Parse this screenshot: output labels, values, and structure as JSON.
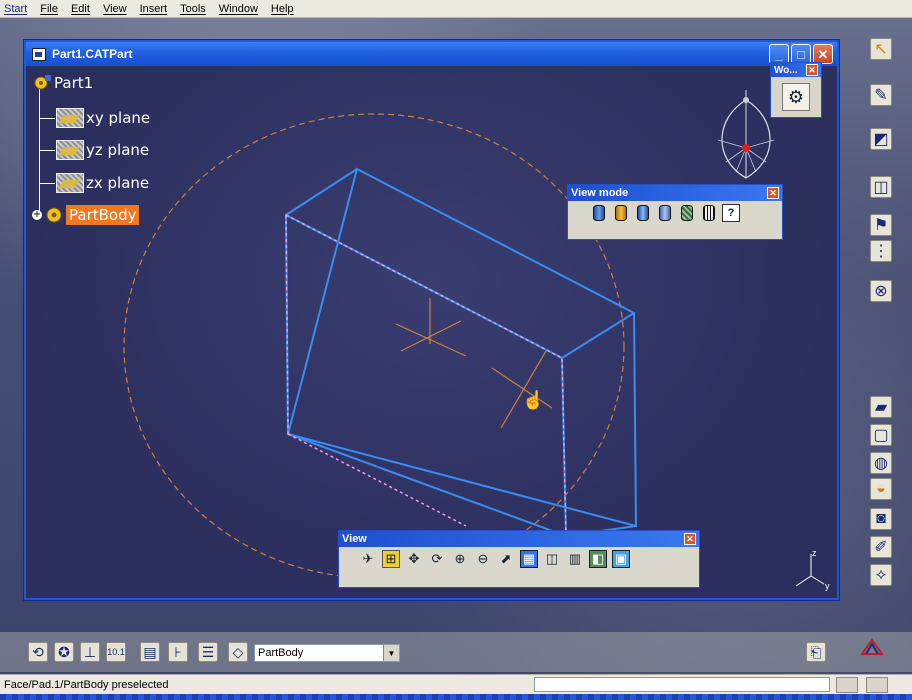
{
  "menu": {
    "items": [
      "Start",
      "File",
      "Edit",
      "View",
      "Insert",
      "Tools",
      "Window",
      "Help"
    ]
  },
  "document": {
    "title": "Part1.CATPart"
  },
  "tree": {
    "root": "Part1",
    "planes": [
      "xy plane",
      "yz plane",
      "zx plane"
    ],
    "body": "PartBody"
  },
  "workbench_box": {
    "title": "Wo..."
  },
  "view_mode_toolbar": {
    "title": "View mode",
    "icons": [
      "shading-icon",
      "shading-edges-icon",
      "shading-edges-no-smooth-icon",
      "shading-edges-hidden-icon",
      "shading-material-icon",
      "wireframe-icon",
      "customize-view-icon"
    ]
  },
  "view_toolbar": {
    "title": "View",
    "icons": [
      "fly-mode-icon",
      "fit-all-icon",
      "pan-icon",
      "rotate-icon",
      "zoom-in-icon",
      "zoom-out-icon",
      "normal-view-icon",
      "multi-view-icon",
      "isometric-view-icon",
      "view-mode-icon",
      "hide-show-icon",
      "swap-space-icon"
    ]
  },
  "bottom_toolbar": {
    "selected_body": "PartBody",
    "icons": [
      "update-icon",
      "refresh-icon",
      "axis-system-icon",
      "measure-icon",
      "material-icon",
      "constraint-icon",
      "layer-icon",
      "filter-icon"
    ]
  },
  "status": {
    "text": "Face/Pad.1/PartBody preselected"
  },
  "right_toolbar": {
    "icons": [
      "select-icon",
      "sketcher-icon",
      "workplane-icon",
      "plane-icon",
      "point-icon",
      "grid-icon",
      "intersect-icon",
      "pad-icon",
      "pocket-icon",
      "shaft-icon",
      "groove-icon",
      "hole-icon",
      "rib-icon",
      "slot-icon"
    ]
  },
  "colors": {
    "viewport_bg": "#2e315f",
    "titlebar_blue": "#1f5fe0",
    "highlight_orange": "#f07820",
    "edge_blue": "#3a8df0",
    "sketch_orange": "#d08040"
  }
}
